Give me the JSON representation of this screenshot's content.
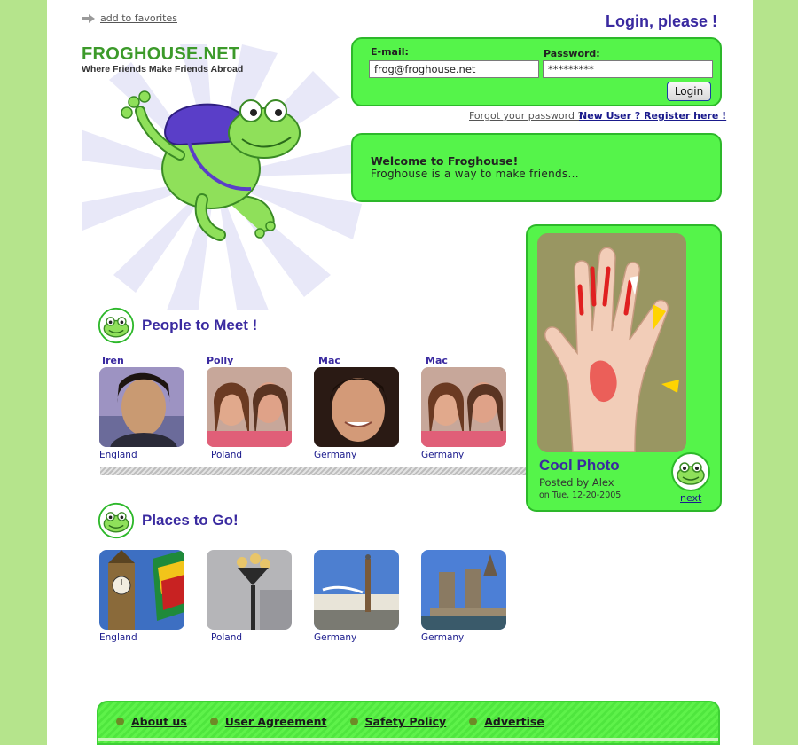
{
  "favorites": {
    "label": "add to favorites"
  },
  "logo": {
    "name": "FROGHOUSE.NET",
    "tagline": "Where Friends Make Friends Abroad"
  },
  "login": {
    "title": "Login, please !",
    "email_label": "E-mail:",
    "email_value": "frog@froghouse.net",
    "password_label": "Password:",
    "password_value": "*********",
    "button": "Login",
    "forgot": "Forgot your password ?",
    "register": "New User ? Register here !"
  },
  "welcome": {
    "title": "Welcome to Froghouse!",
    "text": "Froghouse is a way to make friends..."
  },
  "cool_photo": {
    "title": "Cool Photo",
    "posted_by": "Posted by Alex",
    "date": "on Tue, 12-20-2005",
    "next": "next"
  },
  "people": {
    "title": "People to Meet !",
    "items": [
      {
        "name": "Iren",
        "country": "England"
      },
      {
        "name": "Polly",
        "country": "Poland"
      },
      {
        "name": "Mac",
        "country": "Germany"
      },
      {
        "name": "Mac",
        "country": "Germany"
      }
    ]
  },
  "places": {
    "title": "Places to Go!",
    "items": [
      {
        "country": "England"
      },
      {
        "country": "Poland"
      },
      {
        "country": "Germany"
      },
      {
        "country": "Germany"
      }
    ]
  },
  "footer": {
    "links": [
      "About us",
      "User Agreement",
      "Safety Policy",
      "Advertise"
    ]
  },
  "colors": {
    "accent_green": "#55f44a",
    "title_purple": "#3a2aa0",
    "page_bg": "#b5e48c"
  }
}
